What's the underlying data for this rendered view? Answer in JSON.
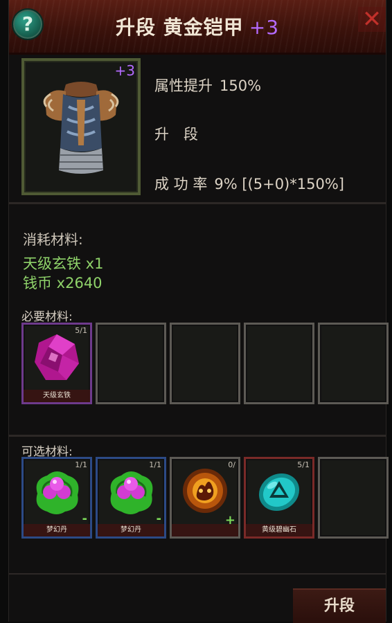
{
  "header": {
    "title": "升段 黄金铠甲",
    "title_plus": "+3",
    "help_label": "?",
    "close_label": "✕"
  },
  "item": {
    "level_plus": "+3",
    "icon": "armor-icon",
    "attr_label": "属性提升",
    "attr_value": "150%",
    "step_label": "升　段",
    "rate_label": "成 功 率",
    "rate_value": "9% [(5+0)*150%]"
  },
  "consume": {
    "title": "消耗材料:",
    "items": [
      "天级玄铁 x1",
      "钱币 x2640"
    ]
  },
  "required": {
    "title": "必要材料:",
    "slots": [
      {
        "name": "天级玄铁",
        "count": "5/1",
        "icon": "purple-crystal-icon"
      },
      {
        "name": "",
        "count": "",
        "icon": ""
      },
      {
        "name": "",
        "count": "",
        "icon": ""
      },
      {
        "name": "",
        "count": "",
        "icon": ""
      },
      {
        "name": "",
        "count": "",
        "icon": ""
      }
    ]
  },
  "optional": {
    "title": "可选材料:",
    "slots": [
      {
        "name": "梦幻丹",
        "count": "1/1",
        "icon": "dream-pill-icon",
        "action": "-"
      },
      {
        "name": "梦幻丹",
        "count": "1/1",
        "icon": "dream-pill-icon",
        "action": "-"
      },
      {
        "name": "",
        "count": "0/",
        "icon": "fire-orb-icon",
        "action": "+"
      },
      {
        "name": "黄级碧幽石",
        "count": "5/1",
        "icon": "jade-rune-stone-icon",
        "action": ""
      },
      {
        "name": "",
        "count": "",
        "icon": "",
        "action": ""
      }
    ]
  },
  "action": {
    "upgrade_label": "升段"
  },
  "colors": {
    "accent_purple": "#b46bff",
    "material_green": "#8fd36a",
    "header_red": "#5a1e14"
  }
}
